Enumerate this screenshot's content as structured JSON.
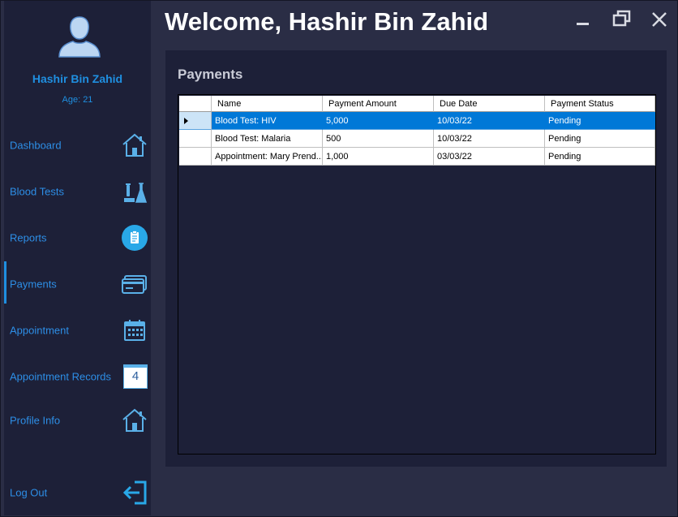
{
  "header": {
    "title": "Welcome, Hashir Bin Zahid"
  },
  "window_controls": {
    "minimize": "minimize-icon",
    "maximize": "restore-icon",
    "close": "close-icon"
  },
  "user": {
    "name": "Hashir Bin Zahid",
    "age_label": "Age:",
    "age": "21"
  },
  "sidebar": {
    "items": [
      {
        "label": "Dashboard",
        "icon": "home-icon"
      },
      {
        "label": "Blood Tests",
        "icon": "lab-flask-icon"
      },
      {
        "label": "Reports",
        "icon": "clipboard-icon"
      },
      {
        "label": "Payments",
        "icon": "credit-cards-icon",
        "active": true
      },
      {
        "label": "Appointment",
        "icon": "calendar-icon"
      },
      {
        "label": "Appointment Records",
        "icon": "calendar-day-icon",
        "badge": "4"
      },
      {
        "label": "Profile Info",
        "icon": "home-icon"
      }
    ],
    "logout": {
      "label": "Log Out",
      "icon": "logout-icon"
    }
  },
  "panel": {
    "title": "Payments"
  },
  "table": {
    "columns": [
      "Name",
      "Payment Amount",
      "Due Date",
      "Payment Status"
    ],
    "rows": [
      {
        "name": "Blood Test: HIV",
        "amount": "5,000",
        "due": "10/03/22",
        "status": "Pending",
        "selected": true
      },
      {
        "name": "Blood Test: Malaria",
        "amount": "500",
        "due": "10/03/22",
        "status": "Pending"
      },
      {
        "name": "Appointment: Mary Prend...",
        "amount": "1,000",
        "due": "03/03/22",
        "status": "Pending"
      }
    ]
  },
  "colors": {
    "accent": "#1f8fe0",
    "sidebar": "#1d2038",
    "background": "#2a2d45",
    "selection": "#0078d7"
  }
}
